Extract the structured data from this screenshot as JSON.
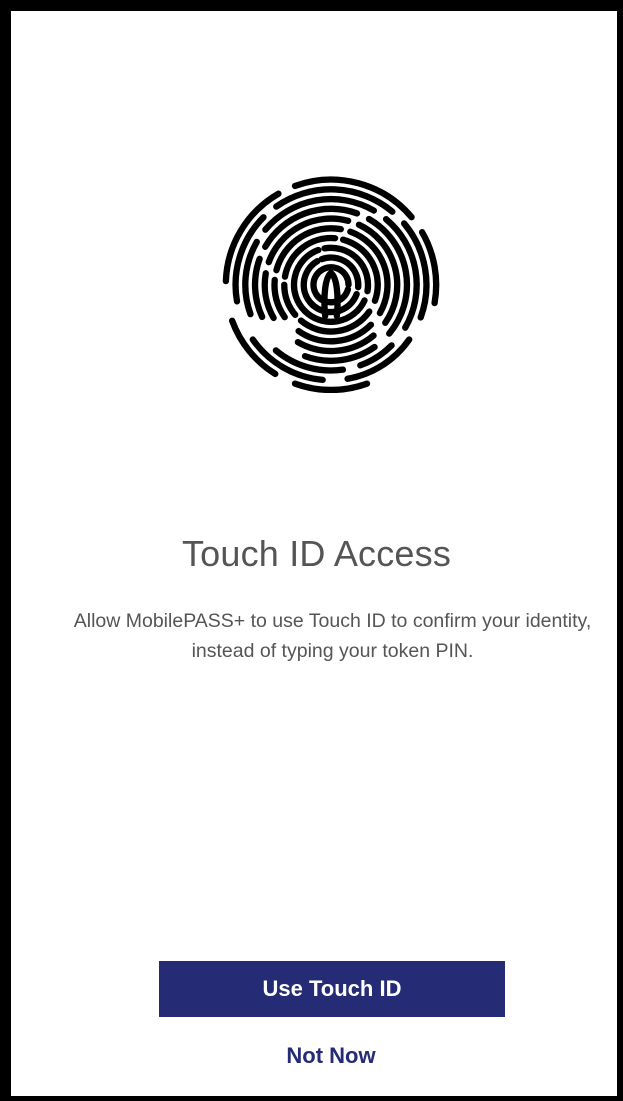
{
  "screen": {
    "icon": "fingerprint-icon",
    "title": "Touch ID Access",
    "description": "Allow MobilePASS+ to use Touch ID to confirm your identity, instead of typing your token PIN."
  },
  "actions": {
    "primary_label": "Use Touch ID",
    "secondary_label": "Not Now"
  },
  "colors": {
    "accent": "#252b74",
    "text": "#555555",
    "frame": "#000000"
  }
}
